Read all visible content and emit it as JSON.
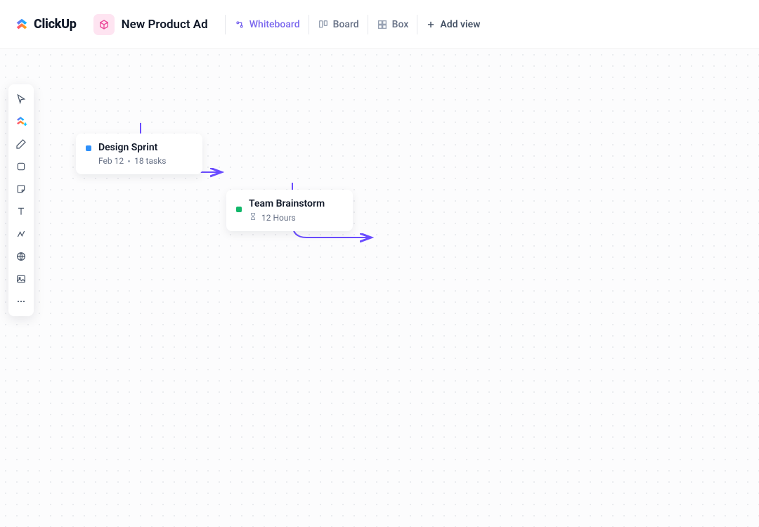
{
  "brand": {
    "name": "ClickUp"
  },
  "project": {
    "name": "New Product Ad"
  },
  "views": {
    "whiteboard": "Whiteboard",
    "board": "Board",
    "box": "Box",
    "add": "Add view"
  },
  "toolbar": {
    "pointer": "pointer",
    "clickup": "clickup-add",
    "pen": "pen",
    "shape": "shape",
    "sticky": "sticky-note",
    "text": "text",
    "connector": "connector",
    "web": "web-embed",
    "image": "image",
    "more": "more"
  },
  "cards": {
    "sprint": {
      "title": "Design Sprint",
      "date": "Feb 12",
      "tasks": "18 tasks"
    },
    "brainstorm": {
      "title": "Team Brainstorm",
      "duration": "12 Hours"
    }
  }
}
